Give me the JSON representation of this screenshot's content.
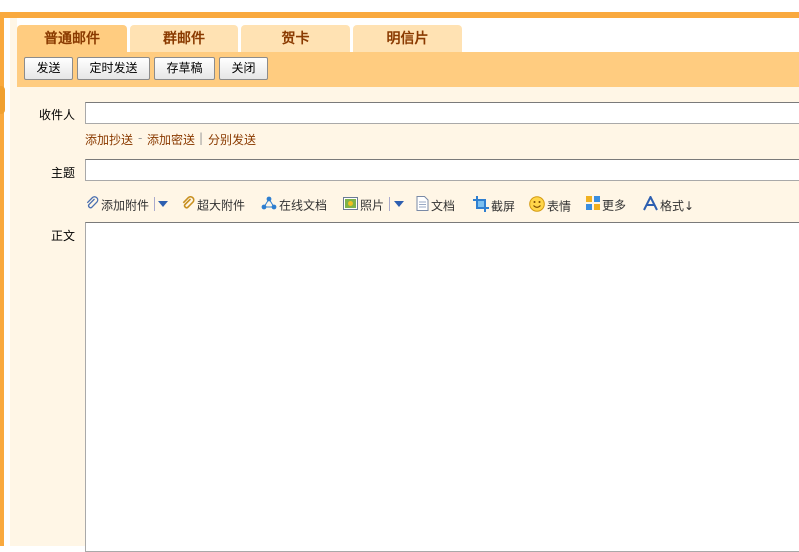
{
  "tabs": [
    {
      "label": "普通邮件",
      "active": true
    },
    {
      "label": "群邮件",
      "active": false
    },
    {
      "label": "贺卡",
      "active": false
    },
    {
      "label": "明信片",
      "active": false
    }
  ],
  "toolbar": {
    "send_label": "发送",
    "schedule_label": "定时发送",
    "draft_label": "存草稿",
    "close_label": "关闭"
  },
  "form": {
    "recipient_label": "收件人",
    "recipient_value": "",
    "add_cc": "添加抄送",
    "add_bcc": "添加密送",
    "separate_send": "分别发送",
    "link_sep_1": "-",
    "link_sep_2": "|",
    "subject_label": "主题",
    "subject_value": "",
    "body_label": "正文",
    "body_value": ""
  },
  "editor_tools": {
    "attach": "添加附件",
    "super_attach": "超大附件",
    "online_doc": "在线文档",
    "photo": "照片",
    "doc": "文档",
    "screenshot": "截屏",
    "emoji": "表情",
    "more": "更多",
    "format": "格式↓"
  },
  "colors": {
    "accent": "#f9a93e",
    "tab_bg": "#ffe2b3",
    "tab_active": "#ffcc80",
    "panel_bg": "#fff6e6",
    "link": "#8a3a00"
  }
}
